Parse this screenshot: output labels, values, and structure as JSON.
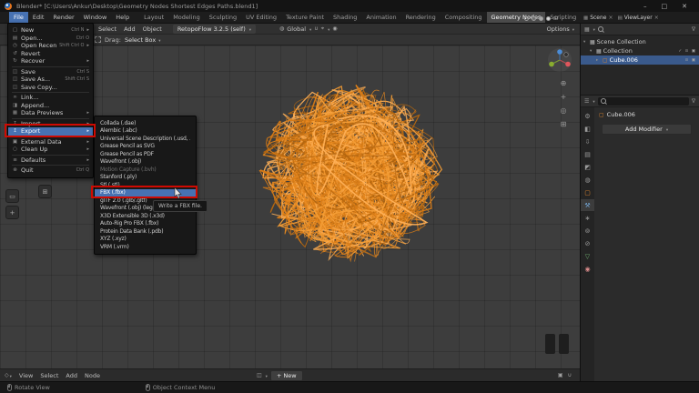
{
  "window": {
    "title": "Blender*  [C:\\Users\\Ankur\\Desktop\\Geometry Nodes Shortest Edges Paths.blend1]",
    "controls": {
      "minimize": "–",
      "maximize": "□",
      "close": "✕"
    }
  },
  "topbar": {
    "menus": [
      "File",
      "Edit",
      "Render",
      "Window",
      "Help"
    ],
    "open_menu": "File",
    "workspaces": [
      "Layout",
      "Modeling",
      "Sculpting",
      "UV Editing",
      "Texture Paint",
      "Shading",
      "Animation",
      "Rendering",
      "Compositing",
      "Geometry Nodes",
      "Scripting"
    ],
    "active_workspace": "Geometry Nodes",
    "scene": {
      "label": "Scene"
    },
    "view_layer": {
      "label": "ViewLayer"
    }
  },
  "viewport_header": {
    "menus": [
      "Select",
      "Add",
      "Object"
    ],
    "tool_dropdown": "RetopoFlow 3.2.5 (self)",
    "orientation": "Global",
    "options": "Options"
  },
  "tool_settings": {
    "drag_label": "Drag:",
    "drag_value": "Select Box"
  },
  "file_menu": {
    "items": [
      {
        "label": "New",
        "icon": "▢",
        "shortcut": "Ctrl N",
        "submenu": true
      },
      {
        "label": "Open...",
        "icon": "▤",
        "shortcut": "Ctrl O"
      },
      {
        "label": "Open Recent",
        "icon": "◷",
        "shortcut": "Shift Ctrl O",
        "submenu": true
      },
      {
        "label": "Revert",
        "icon": "↺"
      },
      {
        "label": "Recover",
        "icon": "↻",
        "submenu": true
      },
      {
        "sep": true
      },
      {
        "label": "Save",
        "icon": "◫",
        "shortcut": "Ctrl S"
      },
      {
        "label": "Save As...",
        "icon": "◫",
        "shortcut": "Shift Ctrl S"
      },
      {
        "label": "Save Copy...",
        "icon": "◫"
      },
      {
        "sep": true
      },
      {
        "label": "Link...",
        "icon": "∞"
      },
      {
        "label": "Append...",
        "icon": "◨"
      },
      {
        "label": "Data Previews",
        "icon": "▦",
        "submenu": true
      },
      {
        "sep": true
      },
      {
        "label": "Import",
        "icon": "↧",
        "submenu": true
      },
      {
        "label": "Export",
        "icon": "↥",
        "submenu": true,
        "highlighted": true
      },
      {
        "sep": true
      },
      {
        "label": "External Data",
        "icon": "▣",
        "submenu": true
      },
      {
        "label": "Clean Up",
        "icon": "○",
        "submenu": true
      },
      {
        "sep": true
      },
      {
        "label": "Defaults",
        "icon": "≡",
        "submenu": true
      },
      {
        "sep": true
      },
      {
        "label": "Quit",
        "icon": "⊗",
        "shortcut": "Ctrl Q"
      }
    ]
  },
  "export_menu": {
    "items": [
      {
        "label": "Collada (.dae)"
      },
      {
        "label": "Alembic (.abc)"
      },
      {
        "label": "Universal Scene Description (.usd, .usdc, .usda)"
      },
      {
        "label": "Grease Pencil as SVG"
      },
      {
        "label": "Grease Pencil as PDF"
      },
      {
        "label": "Wavefront (.obj)"
      },
      {
        "label": "Motion Capture (.bvh)",
        "disabled": true
      },
      {
        "label": "Stanford (.ply)"
      },
      {
        "label": "Stl (.stl)"
      },
      {
        "label": "FBX (.fbx)",
        "highlighted": true
      },
      {
        "label": "glTF 2.0 (.glb/.gltf)"
      },
      {
        "label": "Wavefront (.obj) (legacy)"
      },
      {
        "label": "X3D Extensible 3D (.x3d)"
      },
      {
        "label": "Auto-Rig Pro FBX (.fbx)"
      },
      {
        "label": "Protein Data Bank (.pdb)"
      },
      {
        "label": "XYZ (.xyz)"
      },
      {
        "label": "VRM (.vrm)"
      }
    ],
    "tooltip": "Write a FBX file."
  },
  "outliner": {
    "rows": [
      {
        "label": "Scene Collection",
        "icon": "▦",
        "expander": "▾",
        "depth": 0
      },
      {
        "label": "Collection",
        "icon": "▦",
        "expander": "▾",
        "depth": 1,
        "icons_right": [
          "✓",
          "⊙",
          "▣"
        ]
      },
      {
        "label": "Cube.006",
        "icon": "▢",
        "expander": "▸",
        "depth": 2,
        "selected": true,
        "icons_right": [
          "⊙",
          "▣"
        ]
      }
    ]
  },
  "properties": {
    "breadcrumb": "Cube.006",
    "add_modifier": "Add Modifier",
    "tabs": [
      {
        "name": "tool",
        "glyph": "⚙"
      },
      {
        "name": "render",
        "glyph": "◧"
      },
      {
        "name": "output",
        "glyph": "⇩"
      },
      {
        "name": "view-layer",
        "glyph": "▤"
      },
      {
        "name": "scene",
        "glyph": "◩"
      },
      {
        "name": "world",
        "glyph": "◍"
      },
      {
        "name": "object",
        "glyph": "▢",
        "color": "#e0862d"
      },
      {
        "name": "modifiers",
        "glyph": "⚒",
        "active": true,
        "color": "#74a8d8"
      },
      {
        "name": "particles",
        "glyph": "∗"
      },
      {
        "name": "physics",
        "glyph": "⊚"
      },
      {
        "name": "constraints",
        "glyph": "⊘"
      },
      {
        "name": "object-data",
        "glyph": "▽",
        "color": "#6fae6f"
      },
      {
        "name": "material",
        "glyph": "◉",
        "color": "#d88a8a"
      }
    ]
  },
  "node_editor": {
    "menus": [
      "View",
      "Select",
      "Add",
      "Node"
    ],
    "new_button": "New"
  },
  "status_bar": {
    "hints": [
      {
        "label": "Rotate View"
      },
      {
        "label": "Object Context Menu"
      }
    ]
  },
  "icons": {
    "close": "×",
    "globe": "◍",
    "magnet": "∪",
    "target": "⌖",
    "circle": "◉",
    "zoom": "⊕",
    "pan": "+",
    "camera": "◎",
    "grid": "⊞",
    "nodes": "◇",
    "browse": "◫",
    "plus": "+",
    "pin": "▣",
    "outliner": "▦",
    "properties": "☰",
    "funnel": "∇",
    "object": "▢",
    "scene": "▦",
    "viewlayer": "▤",
    "select_box": "▭",
    "cursor_tool": "+"
  },
  "colors": {
    "accent": "#4772b3",
    "annotation": "#cf0a02",
    "wire_orange": "#e8861e"
  }
}
